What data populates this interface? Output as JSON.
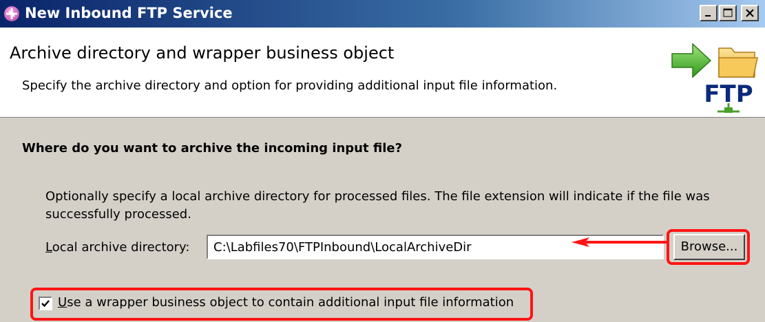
{
  "window": {
    "title": "New Inbound FTP Service"
  },
  "header": {
    "title": "Archive directory and wrapper business object",
    "description": "Specify the archive directory and option for providing additional input file information.",
    "banner_text": "FTP"
  },
  "archive": {
    "question": "Where do you want to archive the incoming input file?",
    "description": "Optionally specify a local archive directory for processed files.  The file extension will indicate if the file was successfully processed.",
    "local_dir_label": "Local archive directory:",
    "local_dir_value": "C:\\Labfiles70\\FTPInbound\\LocalArchiveDir",
    "browse_label": "Browse..."
  },
  "wrapper": {
    "checkbox_label": "Use a wrapper business object to contain additional input file information",
    "checked": true
  },
  "colors": {
    "highlight": "#ff1414",
    "titlebar_start": "#0a246a",
    "titlebar_end": "#a6caf0",
    "dialog_bg": "#d4d0c8"
  }
}
